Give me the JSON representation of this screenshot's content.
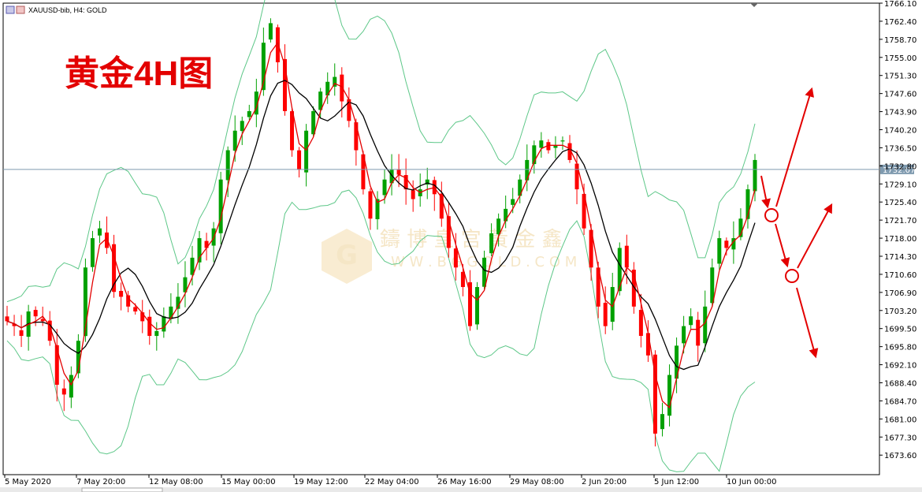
{
  "header": {
    "symbol_line": "XAUUSD-bib, H4:  GOLD",
    "overlay_title": "黄金4H图"
  },
  "watermark": {
    "chinese": "鑄 博 皇 宫 黃 金 鑫",
    "latin": "W W . B G  G O L D . C O M"
  },
  "chart_data": {
    "type": "candlestick",
    "symbol": "XAUUSD-bib",
    "timeframe": "H4",
    "ylim": [
      1669.6,
      1766.1
    ],
    "y_ticks": [
      1766.1,
      1762.4,
      1758.7,
      1755.0,
      1751.3,
      1747.6,
      1743.9,
      1740.2,
      1736.5,
      1732.8,
      1729.1,
      1725.4,
      1721.7,
      1718.0,
      1714.3,
      1710.6,
      1706.9,
      1703.2,
      1699.5,
      1695.8,
      1692.1,
      1688.4,
      1684.7,
      1681.0,
      1677.3,
      1673.6
    ],
    "x_ticks": [
      "5 May 2020",
      "7 May 20:00",
      "12 May 08:00",
      "15 May 00:00",
      "19 May 12:00",
      "22 May 04:00",
      "26 May 16:00",
      "29 May 08:00",
      "2 Jun 20:00",
      "5 Jun 12:00",
      "10 Jun 00:00"
    ],
    "current_price": "1732.07",
    "current_price_value": 1732.07,
    "series": [
      {
        "name": "",
        "kind": "close-path",
        "values": [
          1701,
          1700,
          1698,
          1703,
          1702,
          1701,
          1697,
          1688,
          1686,
          1690,
          1697,
          1712,
          1718,
          1720,
          1716,
          1707,
          1706,
          1704,
          1703,
          1701,
          1698,
          1699,
          1702,
          1704,
          1706,
          1710,
          1714,
          1718,
          1716,
          1720,
          1730,
          1736,
          1740,
          1742,
          1744,
          1748,
          1758,
          1762,
          1754,
          1744,
          1736,
          1732,
          1740,
          1744,
          1748,
          1750,
          1751,
          1746,
          1742,
          1736,
          1728,
          1722,
          1726,
          1730,
          1732,
          1731,
          1728,
          1726,
          1728,
          1730,
          1727,
          1722,
          1716,
          1712,
          1708,
          1700,
          1708,
          1714,
          1719,
          1722,
          1724,
          1726,
          1730,
          1734,
          1737,
          1738,
          1736,
          1737,
          1738,
          1734,
          1728,
          1720,
          1712,
          1704,
          1700,
          1708,
          1716,
          1712,
          1704,
          1698,
          1694,
          1678,
          1682,
          1690,
          1696,
          1700,
          1702,
          1696,
          1704,
          1712,
          1718,
          1716,
          1718,
          1722,
          1728,
          1734
        ]
      }
    ],
    "indicators": [
      "bollinger-bands",
      "fast-moving-average",
      "slow-moving-average"
    ],
    "annotations": {
      "scenario": "two-way breakout from current level",
      "arrows": [
        "down-to-circle",
        "up-from-circle",
        "down-from-circle",
        "up-final"
      ]
    },
    "grid": false,
    "colors": {
      "bull": "#00a000",
      "bear": "#ff0000",
      "bands": "#5dc788",
      "fast_ma": "#e30000",
      "slow_ma": "#000000",
      "price_line": "#7f9aaf"
    }
  }
}
